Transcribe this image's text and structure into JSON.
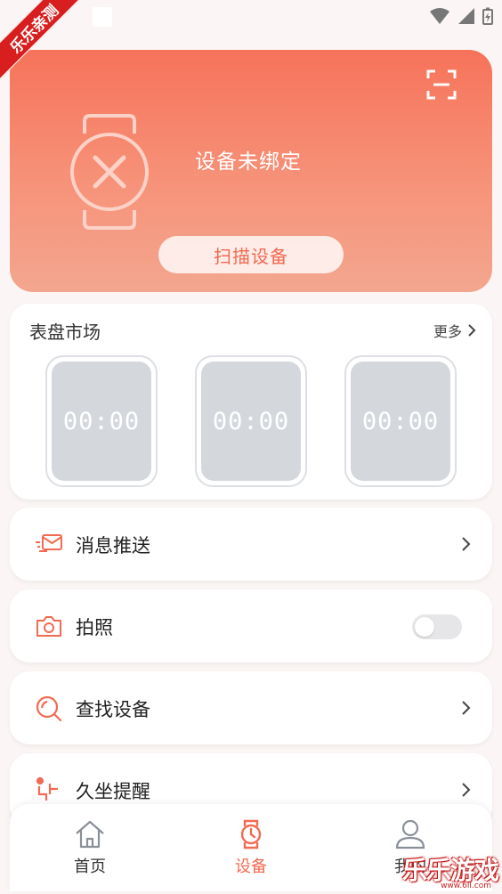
{
  "ribbon": "乐乐亲测",
  "device": {
    "status_text": "设备未绑定",
    "scan_button": "扫描设备",
    "icon": "scan-icon"
  },
  "market": {
    "title": "表盘市场",
    "more": "更多",
    "dials": [
      "00:00",
      "00:00",
      "00:00"
    ]
  },
  "features": [
    {
      "label": "消息推送",
      "icon": "message-icon",
      "control": "chevron"
    },
    {
      "label": "拍照",
      "icon": "camera-icon",
      "control": "toggle",
      "toggle_on": false
    },
    {
      "label": "查找设备",
      "icon": "search-icon",
      "control": "chevron"
    },
    {
      "label": "久坐提醒",
      "icon": "sitting-icon",
      "control": "chevron"
    }
  ],
  "nav": [
    {
      "label": "首页",
      "icon": "home-icon",
      "active": false
    },
    {
      "label": "设备",
      "icon": "watch-icon",
      "active": true
    },
    {
      "label": "我的",
      "icon": "user-icon",
      "active": false
    }
  ],
  "watermark": {
    "text": "乐乐游戏",
    "url": "www.6ll.com"
  },
  "colors": {
    "accent": "#f26a52",
    "card_gradient_top": "#f6735a",
    "card_gradient_bottom": "#f3a68f",
    "dial_screen": "#d4d8dd",
    "background": "#fbf6f5"
  }
}
